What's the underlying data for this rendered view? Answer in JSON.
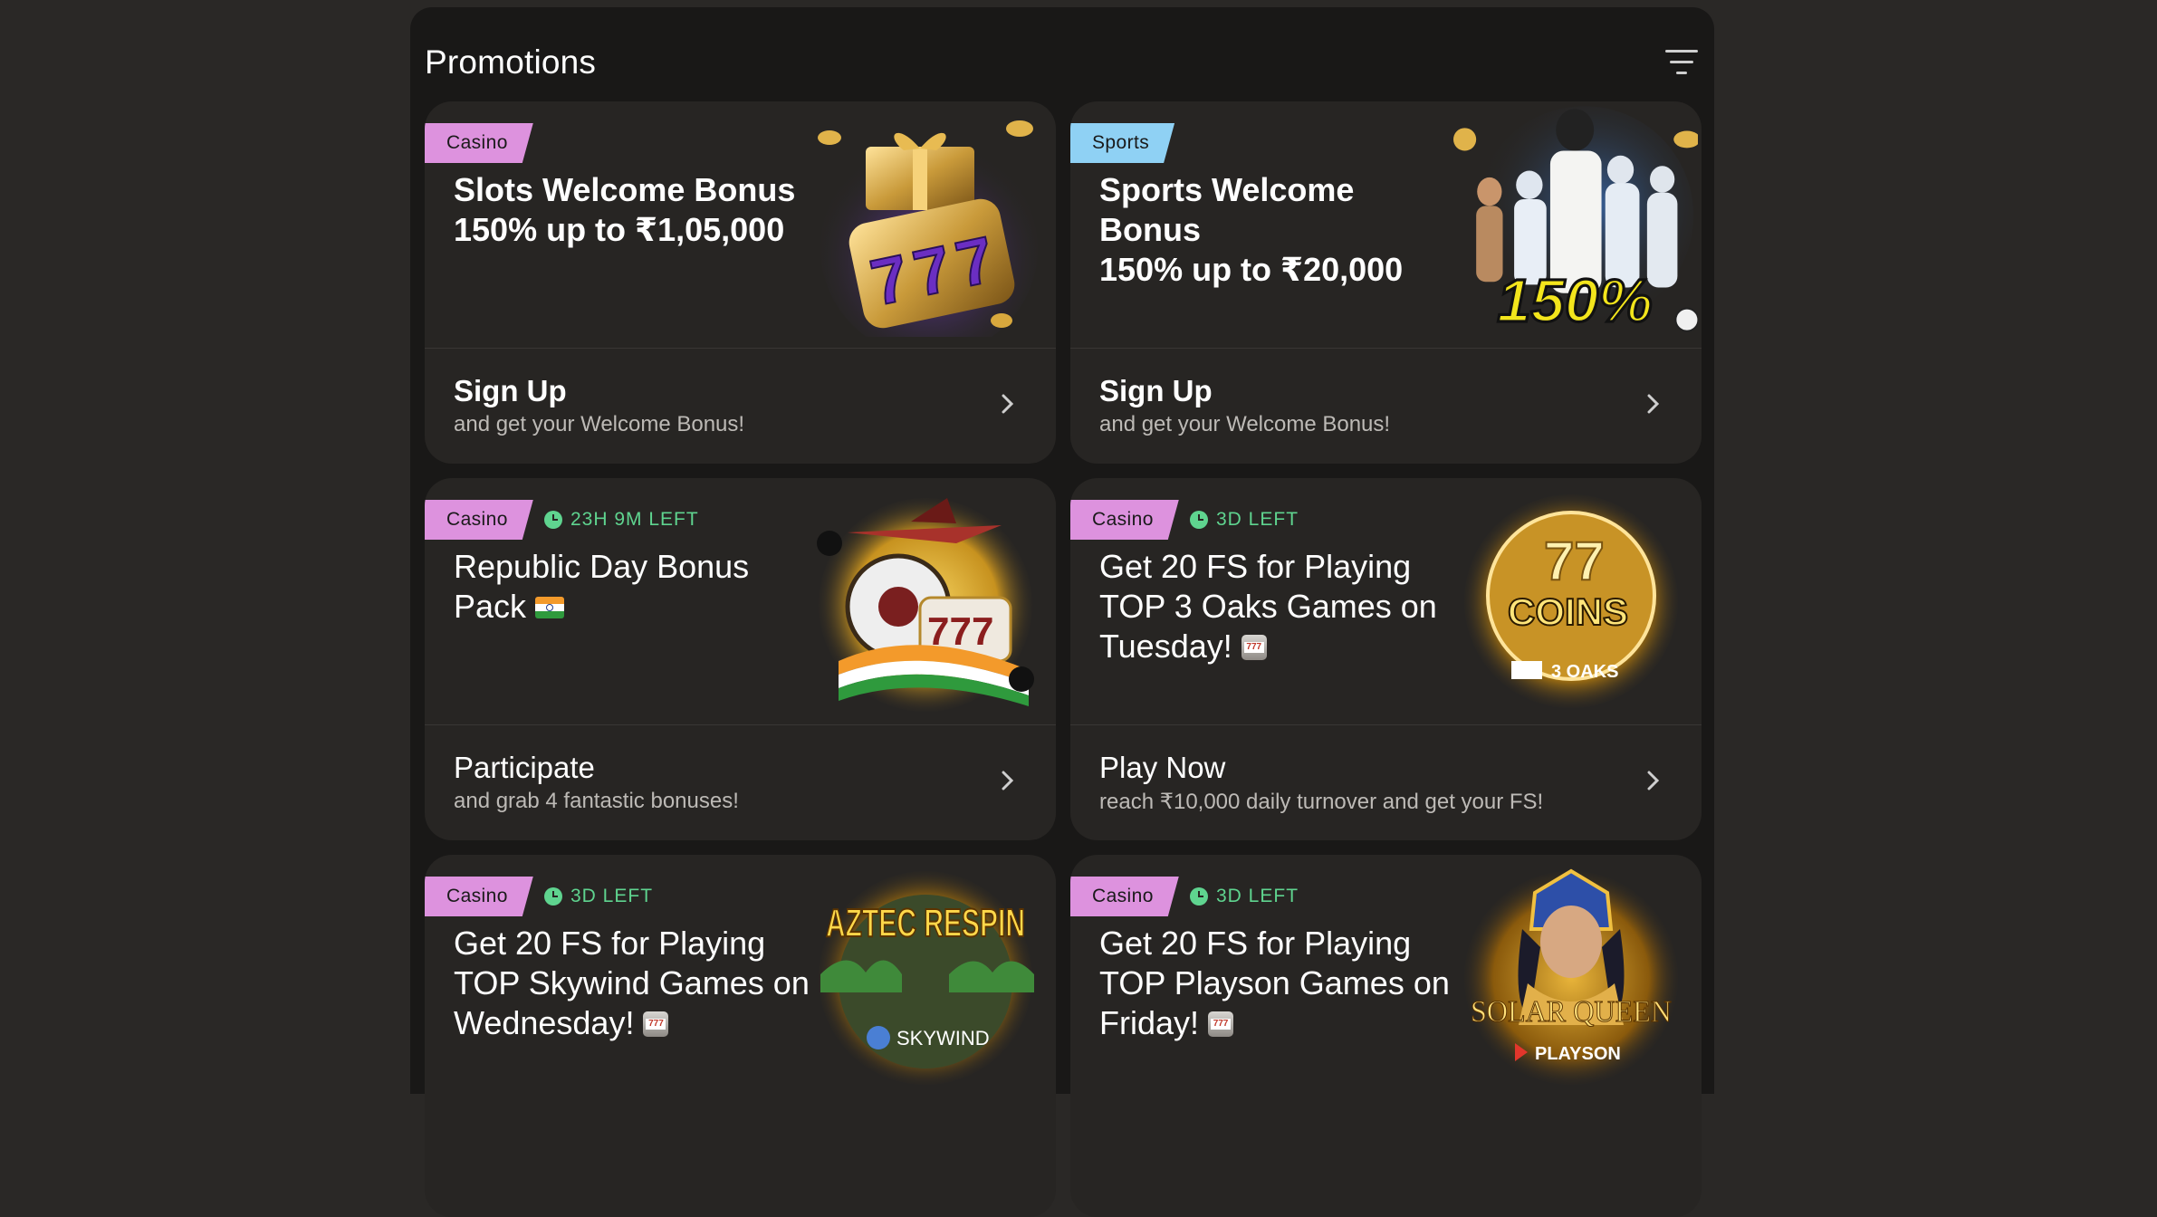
{
  "header": {
    "title": "Promotions",
    "filter_icon": "filter-icon"
  },
  "cards": [
    {
      "tag": "Casino",
      "tag_color": "#dd92de",
      "timer": "",
      "title_line1": "Slots Welcome Bonus",
      "title_line2": "150% up to ₹1,05,000",
      "cta_title": "Sign Up",
      "cta_subtitle": "and get your Welcome Bonus!",
      "image": "golden-777-slot-gift-illustration"
    },
    {
      "tag": "Sports",
      "tag_color": "#8fd1f4",
      "timer": "",
      "title_line1": "Sports Welcome Bonus",
      "title_line2": "150% up to ₹20,000",
      "cta_title": "Sign Up",
      "cta_subtitle": "and get your Welcome Bonus!",
      "image": "athletes-150-percent-illustration",
      "image_text": "150%"
    },
    {
      "tag": "Casino",
      "tag_color": "#dd92de",
      "timer": "23H 9M LEFT",
      "title": "Republic Day Bonus Pack",
      "cta_title": "Participate",
      "cta_subtitle": "and grab 4 fantastic bonuses!",
      "image": "roulette-plane-tricolor-illustration",
      "emoji": "india-flag"
    },
    {
      "tag": "Casino",
      "tag_color": "#dd92de",
      "timer": "3D LEFT",
      "title": "Get 20 FS for Playing TOP 3 Oaks Games on Tuesday!",
      "cta_title": "Play Now",
      "cta_subtitle": "reach ₹10,000 daily turnover and get your FS!",
      "image": "coins-3-oaks-logo",
      "image_text": "COINS",
      "image_subtext": "3 OAKS",
      "emoji": "slot-machine"
    },
    {
      "tag": "Casino",
      "tag_color": "#dd92de",
      "timer": "3D LEFT",
      "title": "Get 20 FS for Playing TOP Skywind Games on Wednesday!",
      "image": "aztec-respin-skywind-logo",
      "image_text": "AZTEC RESPIN",
      "image_subtext": "SKYWIND",
      "emoji": "slot-machine"
    },
    {
      "tag": "Casino",
      "tag_color": "#dd92de",
      "timer": "3D LEFT",
      "title": "Get 20 FS for Playing TOP Playson Games on Friday!",
      "image": "solar-queen-playson-logo",
      "image_text": "SOLAR QUEEN",
      "image_subtext": "PLAYSON",
      "emoji": "slot-machine"
    }
  ],
  "colors": {
    "background": "#2a2826",
    "panel": "#191817",
    "card": "#272523",
    "timer_green": "#5fd48f"
  }
}
